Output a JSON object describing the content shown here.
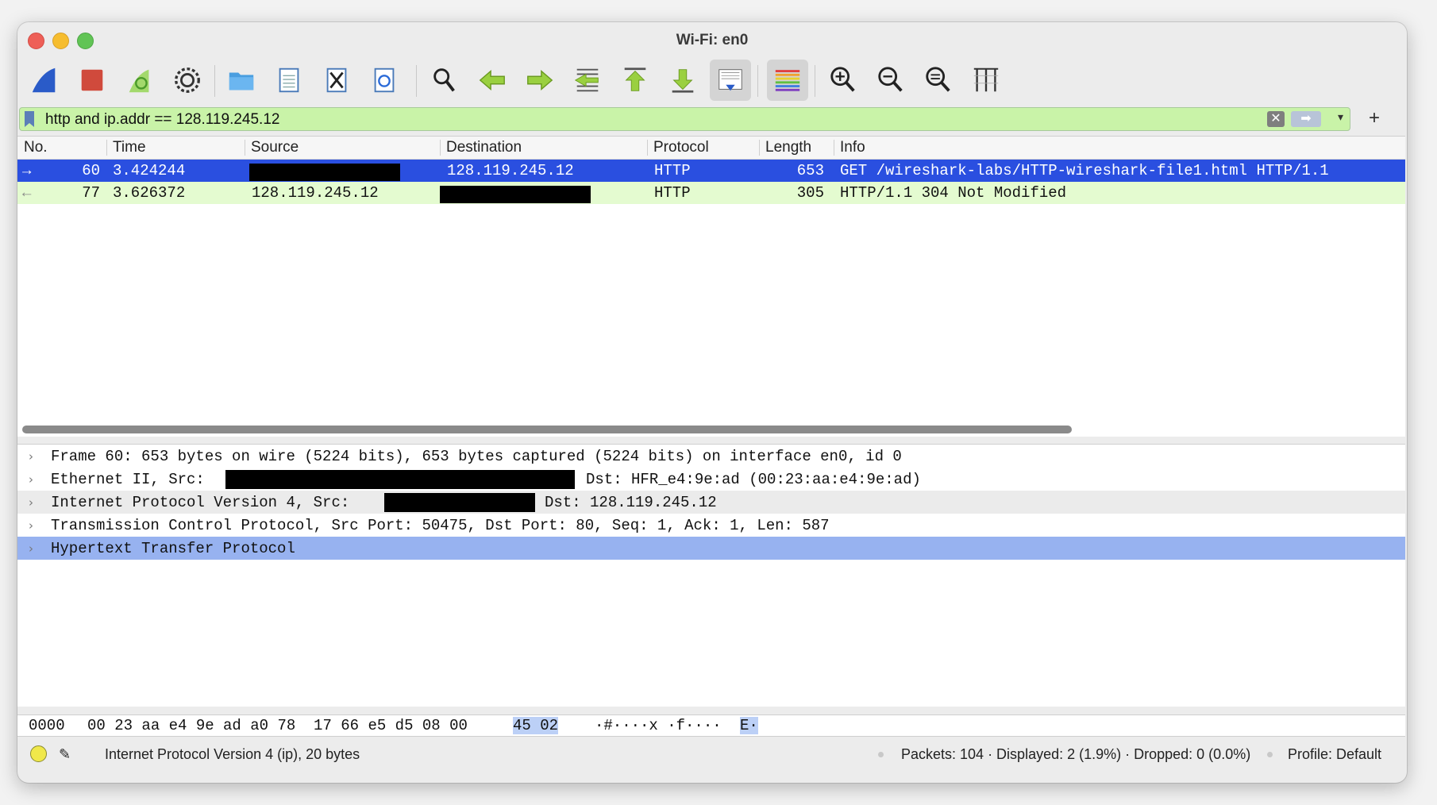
{
  "window": {
    "title": "Wi-Fi: en0"
  },
  "toolbar": {
    "icons": [
      "shark-fin-start-icon",
      "stop-capture-icon",
      "restart-capture-icon",
      "capture-options-gear-icon",
      "open-folder-icon",
      "save-file-icon",
      "close-file-icon",
      "reload-icon",
      "find-packet-icon",
      "go-back-icon",
      "go-forward-icon",
      "go-to-packet-icon",
      "go-first-icon",
      "go-last-icon",
      "auto-scroll-icon",
      "colorize-icon",
      "zoom-in-icon",
      "zoom-out-icon",
      "normal-size-icon",
      "resize-columns-icon"
    ]
  },
  "filter": {
    "value": "http and ip.addr == 128.119.245.12",
    "add_label": "+"
  },
  "packet_list": {
    "columns": [
      "No.",
      "Time",
      "Source",
      "Destination",
      "Protocol",
      "Length",
      "Info"
    ],
    "rows": [
      {
        "no": "60",
        "time": "3.424244",
        "source": "",
        "destination": "128.119.245.12",
        "protocol": "HTTP",
        "length": "653",
        "info": "GET /wireshark-labs/HTTP-wireshark-file1.html HTTP/1.1"
      },
      {
        "no": "77",
        "time": "3.626372",
        "source": "128.119.245.12",
        "destination": "",
        "protocol": "HTTP",
        "length": "305",
        "info": "HTTP/1.1 304 Not Modified"
      }
    ]
  },
  "details": {
    "frame": "Frame 60: 653 bytes on wire (5224 bits), 653 bytes captured (5224 bits) on interface en0, id 0",
    "ethernet_a": "Ethernet II, Src:",
    "ethernet_b": "Dst: HFR_e4:9e:ad (00:23:aa:e4:9e:ad)",
    "ip_a": "Internet Protocol Version 4, Src:",
    "ip_b": "Dst: 128.119.245.12",
    "tcp": "Transmission Control Protocol, Src Port: 50475, Dst Port: 80, Seq: 1, Ack: 1, Len: 587",
    "http": "Hypertext Transfer Protocol"
  },
  "hex": {
    "offset": "0000",
    "bytes_a": "00 23 aa e4 9e ad a0 78  17 66 e5 d5 08 00",
    "bytes_hl": "45 02",
    "ascii_a": "·#····x ·f····",
    "ascii_hl": "E·"
  },
  "status": {
    "field": "Internet Protocol Version 4 (ip), 20 bytes",
    "packets": "Packets: 104 · Displayed: 2 (1.9%) · Dropped: 0 (0.0%)",
    "profile": "Profile: Default"
  }
}
